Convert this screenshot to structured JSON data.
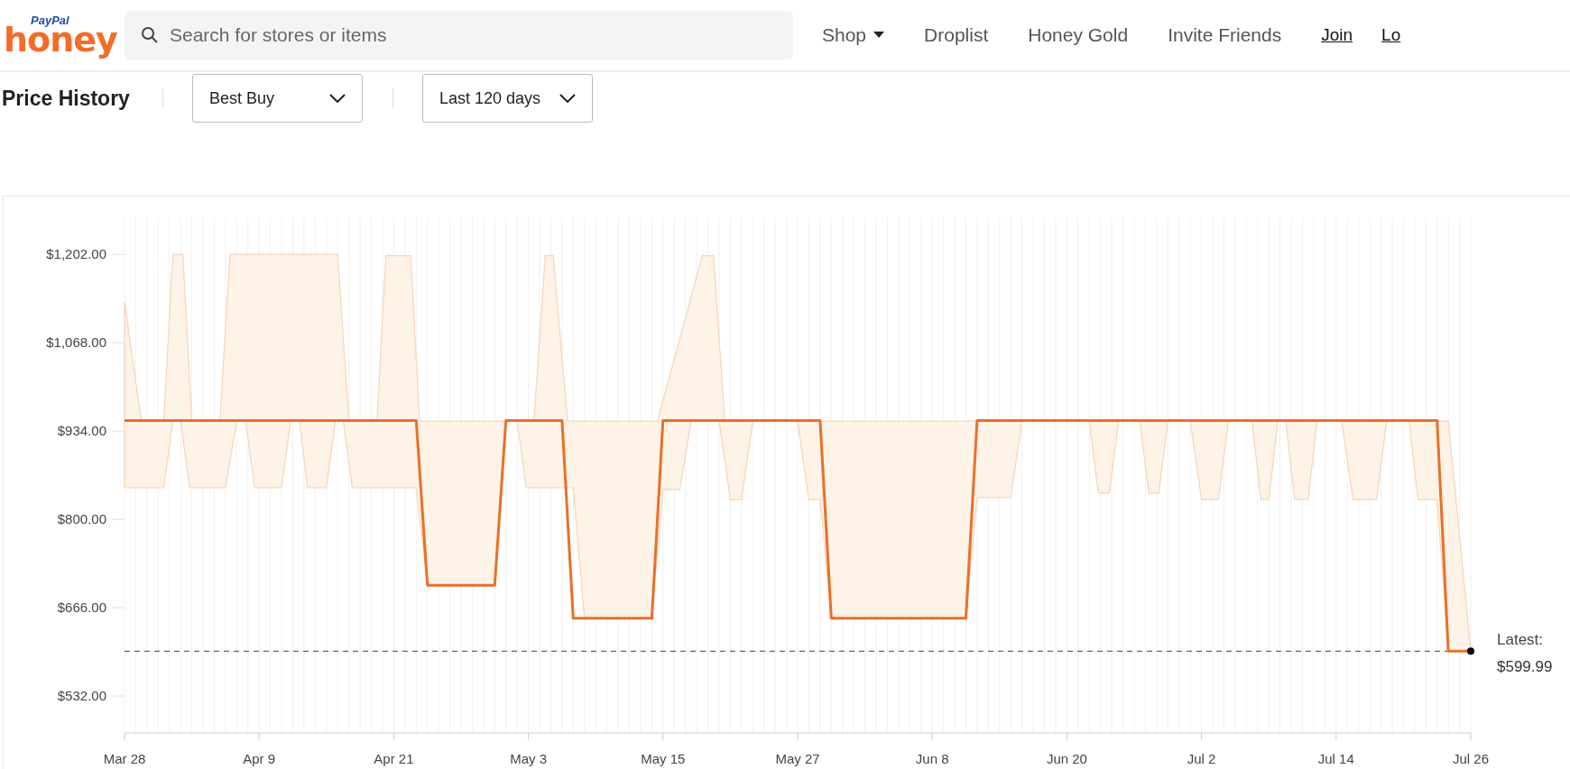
{
  "header": {
    "logo": {
      "top": "PayPal",
      "word": "honey"
    },
    "search": {
      "placeholder": "Search for stores or items"
    },
    "nav": [
      {
        "label": "Shop",
        "kind": "menu"
      },
      {
        "label": "Droplist",
        "kind": "link"
      },
      {
        "label": "Honey Gold",
        "kind": "link"
      },
      {
        "label": "Invite Friends",
        "kind": "link"
      },
      {
        "label": "Join",
        "kind": "account"
      },
      {
        "label": "Lo",
        "kind": "account"
      }
    ]
  },
  "toolbar": {
    "title": "Price History",
    "filters": [
      {
        "value": "Best Buy"
      },
      {
        "value": "Last 120 days"
      }
    ]
  },
  "chart": {
    "chart_data": {
      "type": "line",
      "ylim": [
        476,
        1257
      ],
      "categories": [
        "Mar 28",
        null,
        null,
        null,
        null,
        null,
        null,
        null,
        null,
        null,
        null,
        null,
        "Apr 9",
        null,
        null,
        null,
        null,
        null,
        null,
        null,
        null,
        null,
        null,
        null,
        "Apr 21",
        null,
        null,
        null,
        null,
        null,
        null,
        null,
        null,
        null,
        null,
        null,
        "May 3",
        null,
        null,
        null,
        null,
        null,
        null,
        null,
        null,
        null,
        null,
        null,
        "May 15",
        null,
        null,
        null,
        null,
        null,
        null,
        null,
        null,
        null,
        null,
        null,
        "May 27",
        null,
        null,
        null,
        null,
        null,
        null,
        null,
        null,
        null,
        null,
        null,
        "Jun 8",
        null,
        null,
        null,
        null,
        null,
        null,
        null,
        null,
        null,
        null,
        null,
        "Jun 20",
        null,
        null,
        null,
        null,
        null,
        null,
        null,
        null,
        null,
        null,
        null,
        "Jul 2",
        null,
        null,
        null,
        null,
        null,
        null,
        null,
        null,
        null,
        null,
        null,
        "Jul 14",
        null,
        null,
        null,
        null,
        null,
        null,
        null,
        null,
        null,
        null,
        null,
        "Jul 26"
      ],
      "series": [
        {
          "color": "#e8702a",
          "values": [
            950,
            950,
            950,
            950,
            950,
            950,
            950,
            950,
            950,
            950,
            950,
            950,
            950,
            950,
            950,
            950,
            950,
            950,
            950,
            950,
            950,
            950,
            950,
            950,
            950,
            950,
            950,
            700,
            700,
            700,
            700,
            700,
            700,
            700,
            950,
            950,
            950,
            950,
            950,
            950,
            650,
            650,
            650,
            650,
            650,
            650,
            650,
            650,
            950,
            950,
            950,
            950,
            950,
            950,
            950,
            950,
            950,
            950,
            950,
            950,
            950,
            950,
            950,
            650,
            650,
            650,
            650,
            650,
            650,
            650,
            650,
            650,
            650,
            650,
            650,
            650,
            950,
            950,
            950,
            950,
            950,
            950,
            950,
            950,
            950,
            950,
            950,
            950,
            950,
            950,
            950,
            950,
            950,
            950,
            950,
            950,
            950,
            950,
            950,
            950,
            950,
            950,
            950,
            950,
            950,
            950,
            950,
            950,
            950,
            950,
            950,
            950,
            950,
            950,
            950,
            950,
            950,
            950,
            600,
            600,
            600
          ]
        }
      ],
      "yticks": [
        {
          "value": 532,
          "label": "$532.00"
        },
        {
          "value": 666,
          "label": "$666.00"
        },
        {
          "value": 800,
          "label": "$800.00"
        },
        {
          "value": 934,
          "label": "$934.00"
        },
        {
          "value": 1068,
          "label": "$1,068.00"
        },
        {
          "value": 1202,
          "label": "$1,202.00"
        }
      ],
      "grid": true
    },
    "latest": {
      "label": "Latest:",
      "value": "$599.99"
    }
  }
}
